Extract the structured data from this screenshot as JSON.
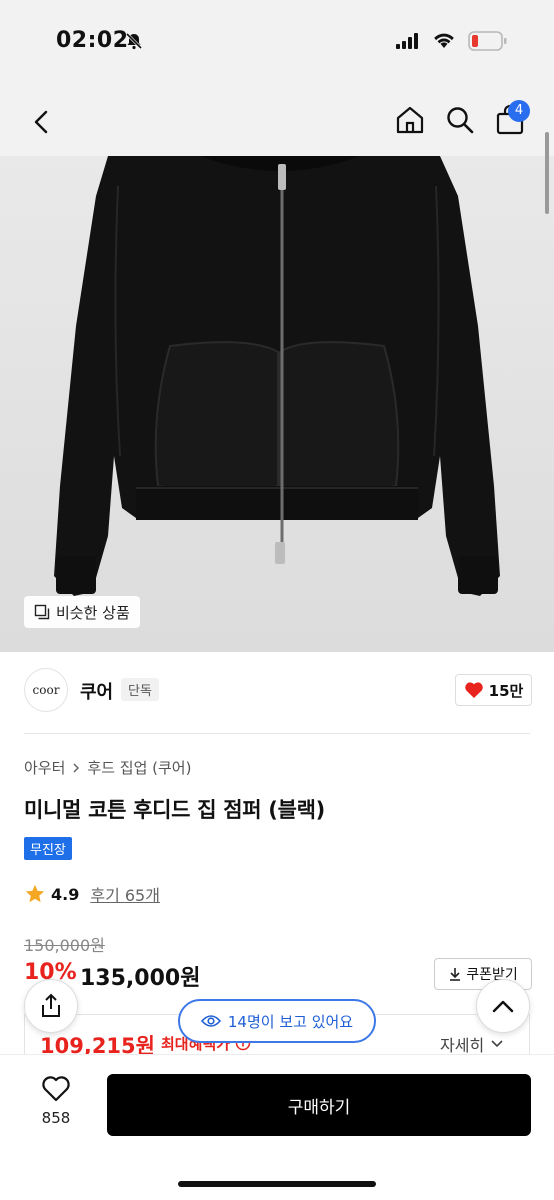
{
  "status_bar": {
    "time": "02:02",
    "mute_icon": "bell-slash-icon",
    "signal_icon": "cellular-signal-icon",
    "wifi_icon": "wifi-icon",
    "battery_icon": "battery-low-icon",
    "battery_color": "#e8372d"
  },
  "nav": {
    "back_icon": "chevron-left-icon",
    "home_icon": "home-icon",
    "search_icon": "search-icon",
    "cart_icon": "shopping-bag-icon",
    "cart_count": "4",
    "badge_color": "#2a6ef0"
  },
  "hero": {
    "similar_label": "비슷한 상품",
    "similar_icon": "similar-items-icon"
  },
  "brand": {
    "logo_text": "coor",
    "name": "쿠어",
    "tag": "단독",
    "likes": "15만",
    "like_icon": "heart-filled-icon",
    "like_color": "#e8231d"
  },
  "breadcrumb": {
    "items": [
      "아우터",
      "후드 집업 (쿠어)"
    ],
    "separator_icon": "chevron-right-icon"
  },
  "product": {
    "title": "미니멀 코튼 후디드 집 점퍼 (블랙)",
    "shipping_badge": "무진장",
    "shipping_color": "#1e6fe8"
  },
  "rating": {
    "score": "4.9",
    "reviews": "후기 65개",
    "star_color": "#f5a623"
  },
  "price": {
    "original": "150,000원",
    "discount": "10%",
    "current": "135,000원",
    "coupon_label": "쿠폰받기",
    "coupon_icon": "download-icon",
    "accent": "#e8231d"
  },
  "max_benefit": {
    "price": "109,215원",
    "label": "최대혜택가",
    "info_icon": "info-icon",
    "details_label": "자세히"
  },
  "floating": {
    "share_icon": "share-icon",
    "scroll_top_icon": "chevron-up-icon",
    "viewers_text": "14명이 보고 있어요",
    "eye_icon": "eye-icon",
    "viewers_color": "#3d78e8"
  },
  "bottom_bar": {
    "wish_icon": "heart-outline-icon",
    "wish_count": "858",
    "buy_label": "구매하기"
  }
}
